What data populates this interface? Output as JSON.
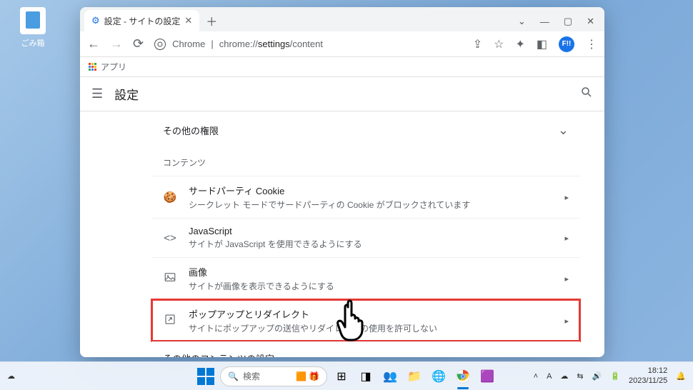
{
  "desktop": {
    "recycle_bin": "ごみ箱"
  },
  "browser": {
    "tab_title": "設定 - サイトの設定",
    "url_prefix": "Chrome",
    "url_path_grey": "chrome://",
    "url_path_dark": "settings",
    "url_path_tail": "/content",
    "bookmarks_apps": "アプリ"
  },
  "settings": {
    "header": "設定",
    "other_permissions": "その他の権限",
    "content_section": "コンテンツ",
    "rows": [
      {
        "icon": "cookie",
        "title": "サードパーティ Cookie",
        "desc": "シークレット モードでサードパーティの Cookie がブロックされています"
      },
      {
        "icon": "code",
        "title": "JavaScript",
        "desc": "サイトが JavaScript を使用できるようにする"
      },
      {
        "icon": "image",
        "title": "画像",
        "desc": "サイトが画像を表示できるようにする"
      },
      {
        "icon": "popup",
        "title": "ポップアップとリダイレクト",
        "desc": "サイトにポップアップの送信やリダイレクトの使用を許可しない"
      }
    ],
    "other_content": "その他のコンテンツの設定"
  },
  "taskbar": {
    "search_placeholder": "検索",
    "ime": "A",
    "time": "18:12",
    "date": "2023/11/25",
    "avatar": "F!!"
  }
}
